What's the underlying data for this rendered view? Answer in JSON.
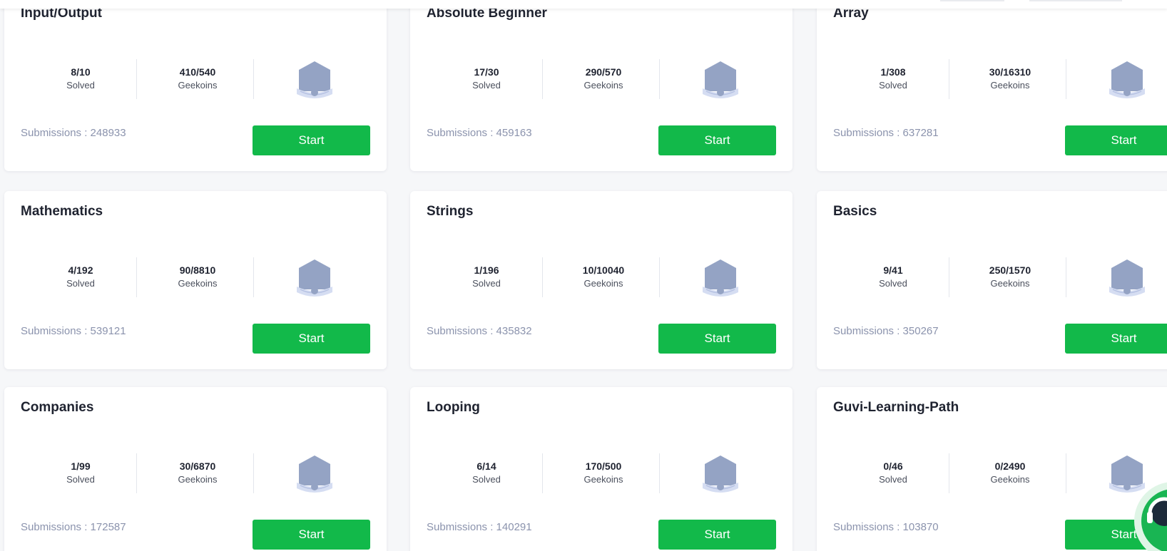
{
  "colors": {
    "accent": "#12b94a",
    "badge_fill": "#94a3c4",
    "badge_ribbon": "#d5ddf2",
    "muted_text": "#8b93ad"
  },
  "cards": [
    {
      "title": "Input/Output",
      "solved": "8/10",
      "solved_label": "Solved",
      "geekoins": "410/540",
      "geekoins_label": "Geekoins",
      "submissions": "Submissions : 248933",
      "button": "Start",
      "badge_icon": "badge-icon"
    },
    {
      "title": "Absolute Beginner",
      "solved": "17/30",
      "solved_label": "Solved",
      "geekoins": "290/570",
      "geekoins_label": "Geekoins",
      "submissions": "Submissions : 459163",
      "button": "Start",
      "badge_icon": "badge-icon"
    },
    {
      "title": "Array",
      "solved": "1/308",
      "solved_label": "Solved",
      "geekoins": "30/16310",
      "geekoins_label": "Geekoins",
      "submissions": "Submissions : 637281",
      "button": "Start",
      "badge_icon": "badge-icon"
    },
    {
      "title": "Mathematics",
      "solved": "4/192",
      "solved_label": "Solved",
      "geekoins": "90/8810",
      "geekoins_label": "Geekoins",
      "submissions": "Submissions : 539121",
      "button": "Start",
      "badge_icon": "badge-icon"
    },
    {
      "title": "Strings",
      "solved": "1/196",
      "solved_label": "Solved",
      "geekoins": "10/10040",
      "geekoins_label": "Geekoins",
      "submissions": "Submissions : 435832",
      "button": "Start",
      "badge_icon": "badge-icon"
    },
    {
      "title": "Basics",
      "solved": "9/41",
      "solved_label": "Solved",
      "geekoins": "250/1570",
      "geekoins_label": "Geekoins",
      "submissions": "Submissions : 350267",
      "button": "Start",
      "badge_icon": "badge-icon"
    },
    {
      "title": "Companies",
      "solved": "1/99",
      "solved_label": "Solved",
      "geekoins": "30/6870",
      "geekoins_label": "Geekoins",
      "submissions": "Submissions : 172587",
      "button": "Start",
      "badge_icon": "badge-icon"
    },
    {
      "title": "Looping",
      "solved": "6/14",
      "solved_label": "Solved",
      "geekoins": "170/500",
      "geekoins_label": "Geekoins",
      "submissions": "Submissions : 140291",
      "button": "Start",
      "badge_icon": "badge-icon"
    },
    {
      "title": "Guvi-Learning-Path",
      "solved": "0/46",
      "solved_label": "Solved",
      "geekoins": "0/2490",
      "geekoins_label": "Geekoins",
      "submissions": "Submissions : 103870",
      "button": "Start",
      "badge_icon": "badge-icon"
    }
  ],
  "chat_widget": {
    "icon": "support-headset-icon"
  }
}
